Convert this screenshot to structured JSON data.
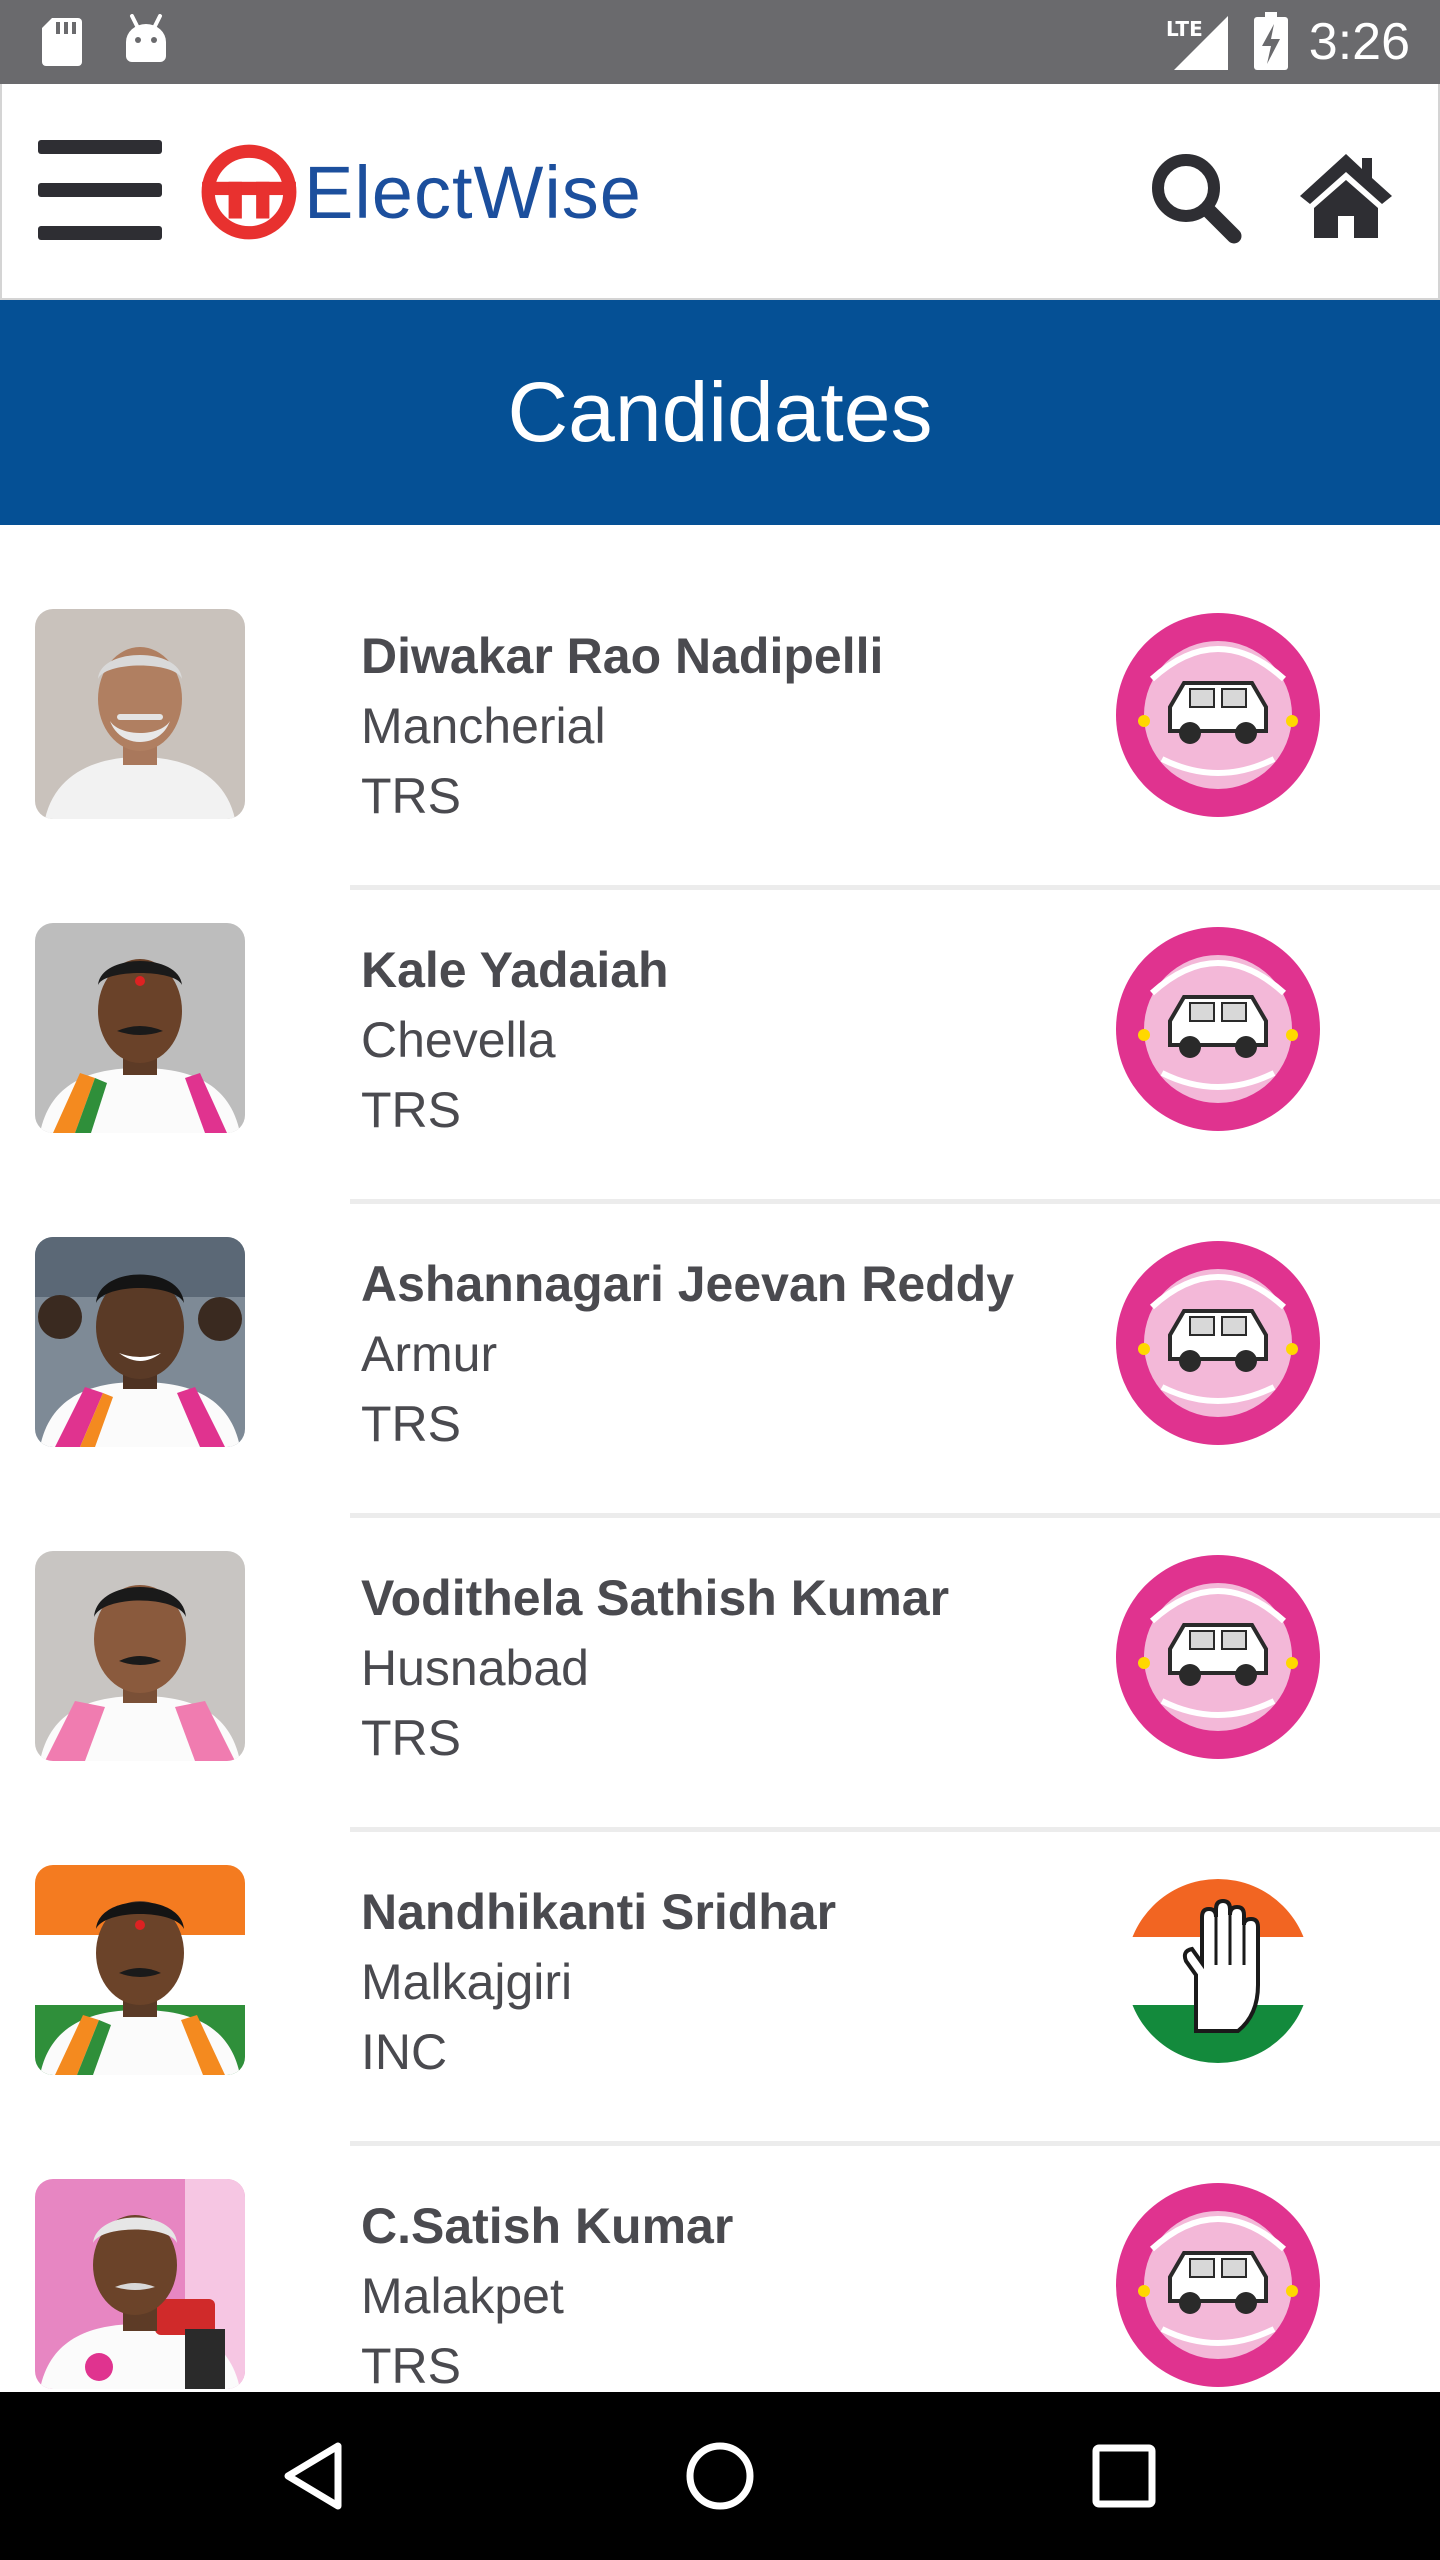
{
  "status_bar": {
    "time": "3:26",
    "network": "LTE",
    "icons": [
      "sd-card-icon",
      "android-debug-icon",
      "lte-signal-icon",
      "battery-charging-icon"
    ]
  },
  "app_bar": {
    "menu_icon": "hamburger-menu-icon",
    "logo_text": "ElectWise",
    "search_icon": "search-icon",
    "home_icon": "home-icon",
    "brand_color": "#1c4f9d",
    "logo_accent": "#e8312f"
  },
  "page": {
    "title": "Candidates",
    "header_color": "#055095"
  },
  "candidates": [
    {
      "name": "Diwakar Rao Nadipelli",
      "constituency": "Mancherial",
      "party": "TRS",
      "party_logo": "trs-car-logo"
    },
    {
      "name": "Kale Yadaiah",
      "constituency": "Chevella",
      "party": "TRS",
      "party_logo": "trs-car-logo"
    },
    {
      "name": "Ashannagari Jeevan Reddy",
      "constituency": "Armur",
      "party": "TRS",
      "party_logo": "trs-car-logo"
    },
    {
      "name": "Vodithela Sathish Kumar",
      "constituency": "Husnabad",
      "party": "TRS",
      "party_logo": "trs-car-logo"
    },
    {
      "name": "Nandhikanti Sridhar",
      "constituency": "Malkajgiri",
      "party": "INC",
      "party_logo": "inc-hand-logo"
    },
    {
      "name": "C.Satish Kumar",
      "constituency": "Malakpet",
      "party": "TRS",
      "party_logo": "trs-car-logo"
    }
  ],
  "nav_bar": {
    "back_icon": "back-triangle-icon",
    "home_icon": "home-circle-icon",
    "recents_icon": "recents-square-icon"
  }
}
